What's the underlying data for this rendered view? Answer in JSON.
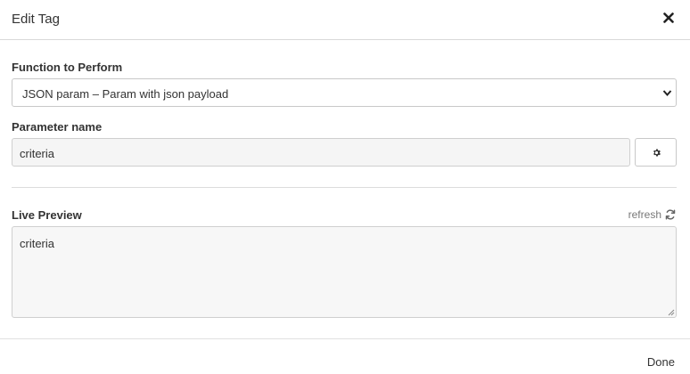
{
  "modal": {
    "title": "Edit Tag"
  },
  "function_field": {
    "label": "Function to Perform",
    "selected": "JSON param – Param with json payload"
  },
  "parameter_field": {
    "label": "Parameter name",
    "value": "criteria"
  },
  "preview": {
    "label": "Live Preview",
    "refresh_label": "refresh",
    "content": "criteria"
  },
  "footer": {
    "done_label": "Done"
  },
  "icons": {
    "close": "close-icon",
    "gear": "gear-icon",
    "refresh": "refresh-icon",
    "chevron": "chevron-down-icon"
  }
}
